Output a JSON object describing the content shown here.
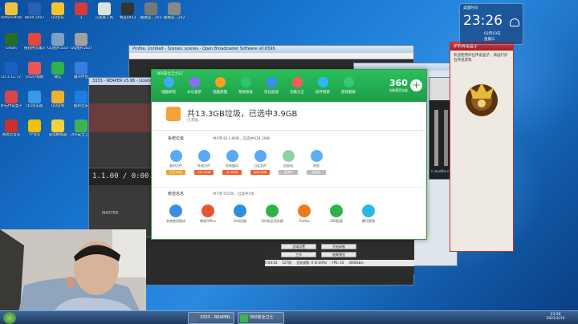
{
  "desktop_icons": [
    {
      "label": "Administrato...",
      "color": "#f0c040"
    },
    {
      "label": "Word 2007",
      "color": "#2b5fb3"
    },
    {
      "label": "QQ音乐",
      "color": "#f5c22b"
    },
    {
      "label": "1",
      "color": "#d33b3b"
    },
    {
      "label": "ix宽屏工具",
      "color": "#e0e0e0"
    },
    {
      "label": "制品0453",
      "color": "#333"
    },
    {
      "label": "截图是...2020981...",
      "color": "#777"
    },
    {
      "label": "截图是...2020891...",
      "color": "#888"
    },
    {
      "label": "Gman",
      "color": "#2a6b2a"
    },
    {
      "label": "搜狗拼音输入法",
      "color": "#e04a3a"
    },
    {
      "label": "QQ图片20200814...",
      "color": "#7da0c8"
    },
    {
      "label": "QQ图片20191224...",
      "color": "#a0a0a0"
    },
    {
      "label": "LU-2.12.17",
      "color": "#1c5fbf"
    },
    {
      "label": "火山小视频",
      "color": "#e55"
    },
    {
      "label": "微信",
      "color": "#2fb24a"
    },
    {
      "label": "魔声伴侣",
      "color": "#3a7de0"
    },
    {
      "label": "炉石传说盒子",
      "color": "#d44"
    },
    {
      "label": "QQ浏览器",
      "color": "#3b9ae8"
    },
    {
      "label": "QQ游戏",
      "color": "#f0b030"
    },
    {
      "label": "酷狗音乐",
      "color": "#1e7de0"
    },
    {
      "label": "网易云音乐",
      "color": "#c83030"
    },
    {
      "label": "YY语音",
      "color": "#f2c200"
    },
    {
      "label": "雷电模拟器",
      "color": "#f3d23c"
    },
    {
      "label": "360安全卫士",
      "color": "#3fb552"
    }
  ],
  "obs_window": {
    "title": "Profile: Untitled - Scenes: scenes - Open Broadcaster Software v0.659b"
  },
  "reaper_window": {
    "title": "3333 - REAPER v5.96 - Licensed for personal/small business use",
    "time_display": "1.1.00 / 0:00.000",
    "master_label": "MASTER"
  },
  "s360": {
    "title": "360安全卫士12",
    "tools": [
      {
        "label": "电脑体检",
        "color": "#40a9ff"
      },
      {
        "label": "木马查杀",
        "color": "#8f6bff"
      },
      {
        "label": "电脑清理",
        "color": "#ff9f1a"
      },
      {
        "label": "系统修复",
        "color": "#2fc36b"
      },
      {
        "label": "优化加速",
        "color": "#3d8bff"
      },
      {
        "label": "功能大全",
        "color": "#ff5a5a"
      },
      {
        "label": "软件管家",
        "color": "#2db7ff"
      },
      {
        "label": "游戏管家",
        "color": "#35c97a"
      }
    ],
    "brand": "360",
    "brand_sub": "电脑管家加速",
    "summary": "共13.3GB垃圾，已选中3.9GB",
    "summary_sub": "已清理...",
    "sec1_title": "系统垃圾",
    "sec1_stat": "共4项 813.8MB，已选中634.5MB",
    "clean_items": [
      {
        "label": "临时文件",
        "badge": "小于1MB",
        "color": "#5aa9f3",
        "badge_color": "#f0a030"
      },
      {
        "label": "系统文件",
        "badge": "125.5MB",
        "color": "#5aa9f3",
        "badge_color": "#f06030"
      },
      {
        "label": "系统缓存",
        "badge": "40.6MB",
        "color": "#5aa9f3",
        "badge_color": "#f06030"
      },
      {
        "label": "日志文件",
        "badge": "468.3MB",
        "color": "#5aa9f3",
        "badge_color": "#f06030"
      },
      {
        "label": "回收站",
        "badge": "未选中",
        "color": "#8fd3a0",
        "badge_color": "#bbbbbb"
      },
      {
        "label": "其他",
        "badge": "未选中",
        "color": "#5ab0f3",
        "badge_color": "#bbbbbb"
      }
    ],
    "sec2_title": "痕迹信息",
    "sec2_stat": "共7项 555条，已选中5条",
    "app_items": [
      {
        "label": "系统使用痕迹",
        "color": "#3b8fe0"
      },
      {
        "label": "微软Office",
        "color": "#e8552a"
      },
      {
        "label": "IE浏览器",
        "color": "#2a8fe0"
      },
      {
        "label": "360安全浏览器",
        "color": "#2fb24a"
      },
      {
        "label": "Firefox",
        "color": "#f07a1a"
      },
      {
        "label": "360极速",
        "color": "#2fb24a"
      },
      {
        "label": "腾讯视频",
        "color": "#28b8e8"
      }
    ]
  },
  "obs_controls": {
    "buttons": [
      "全域设置",
      "开始录制",
      "工作",
      "效果预览"
    ],
    "status": [
      "0:04:24",
      "527帧",
      "丢失帧数: 0 (0.00%)",
      "FPS: 24",
      "3000kb/s"
    ]
  },
  "hearthstone": {
    "title": "炉石传说盒子",
    "text": "欢迎使用炉石传说盒子，请运行炉石传说游戏"
  },
  "clock_widget": {
    "header": "桌面时间",
    "time": "23:26",
    "date": "02月10日",
    "weekday": "星期三"
  },
  "audio": {
    "brand": "c-audio.cn"
  },
  "taskbar": {
    "buttons": [
      {
        "label": "3333 - REAPER...",
        "color": "#5a6b80"
      },
      {
        "label": "360安全卫士",
        "color": "#3fb552"
      }
    ],
    "time": "23:26",
    "date": "2021/2/10"
  }
}
